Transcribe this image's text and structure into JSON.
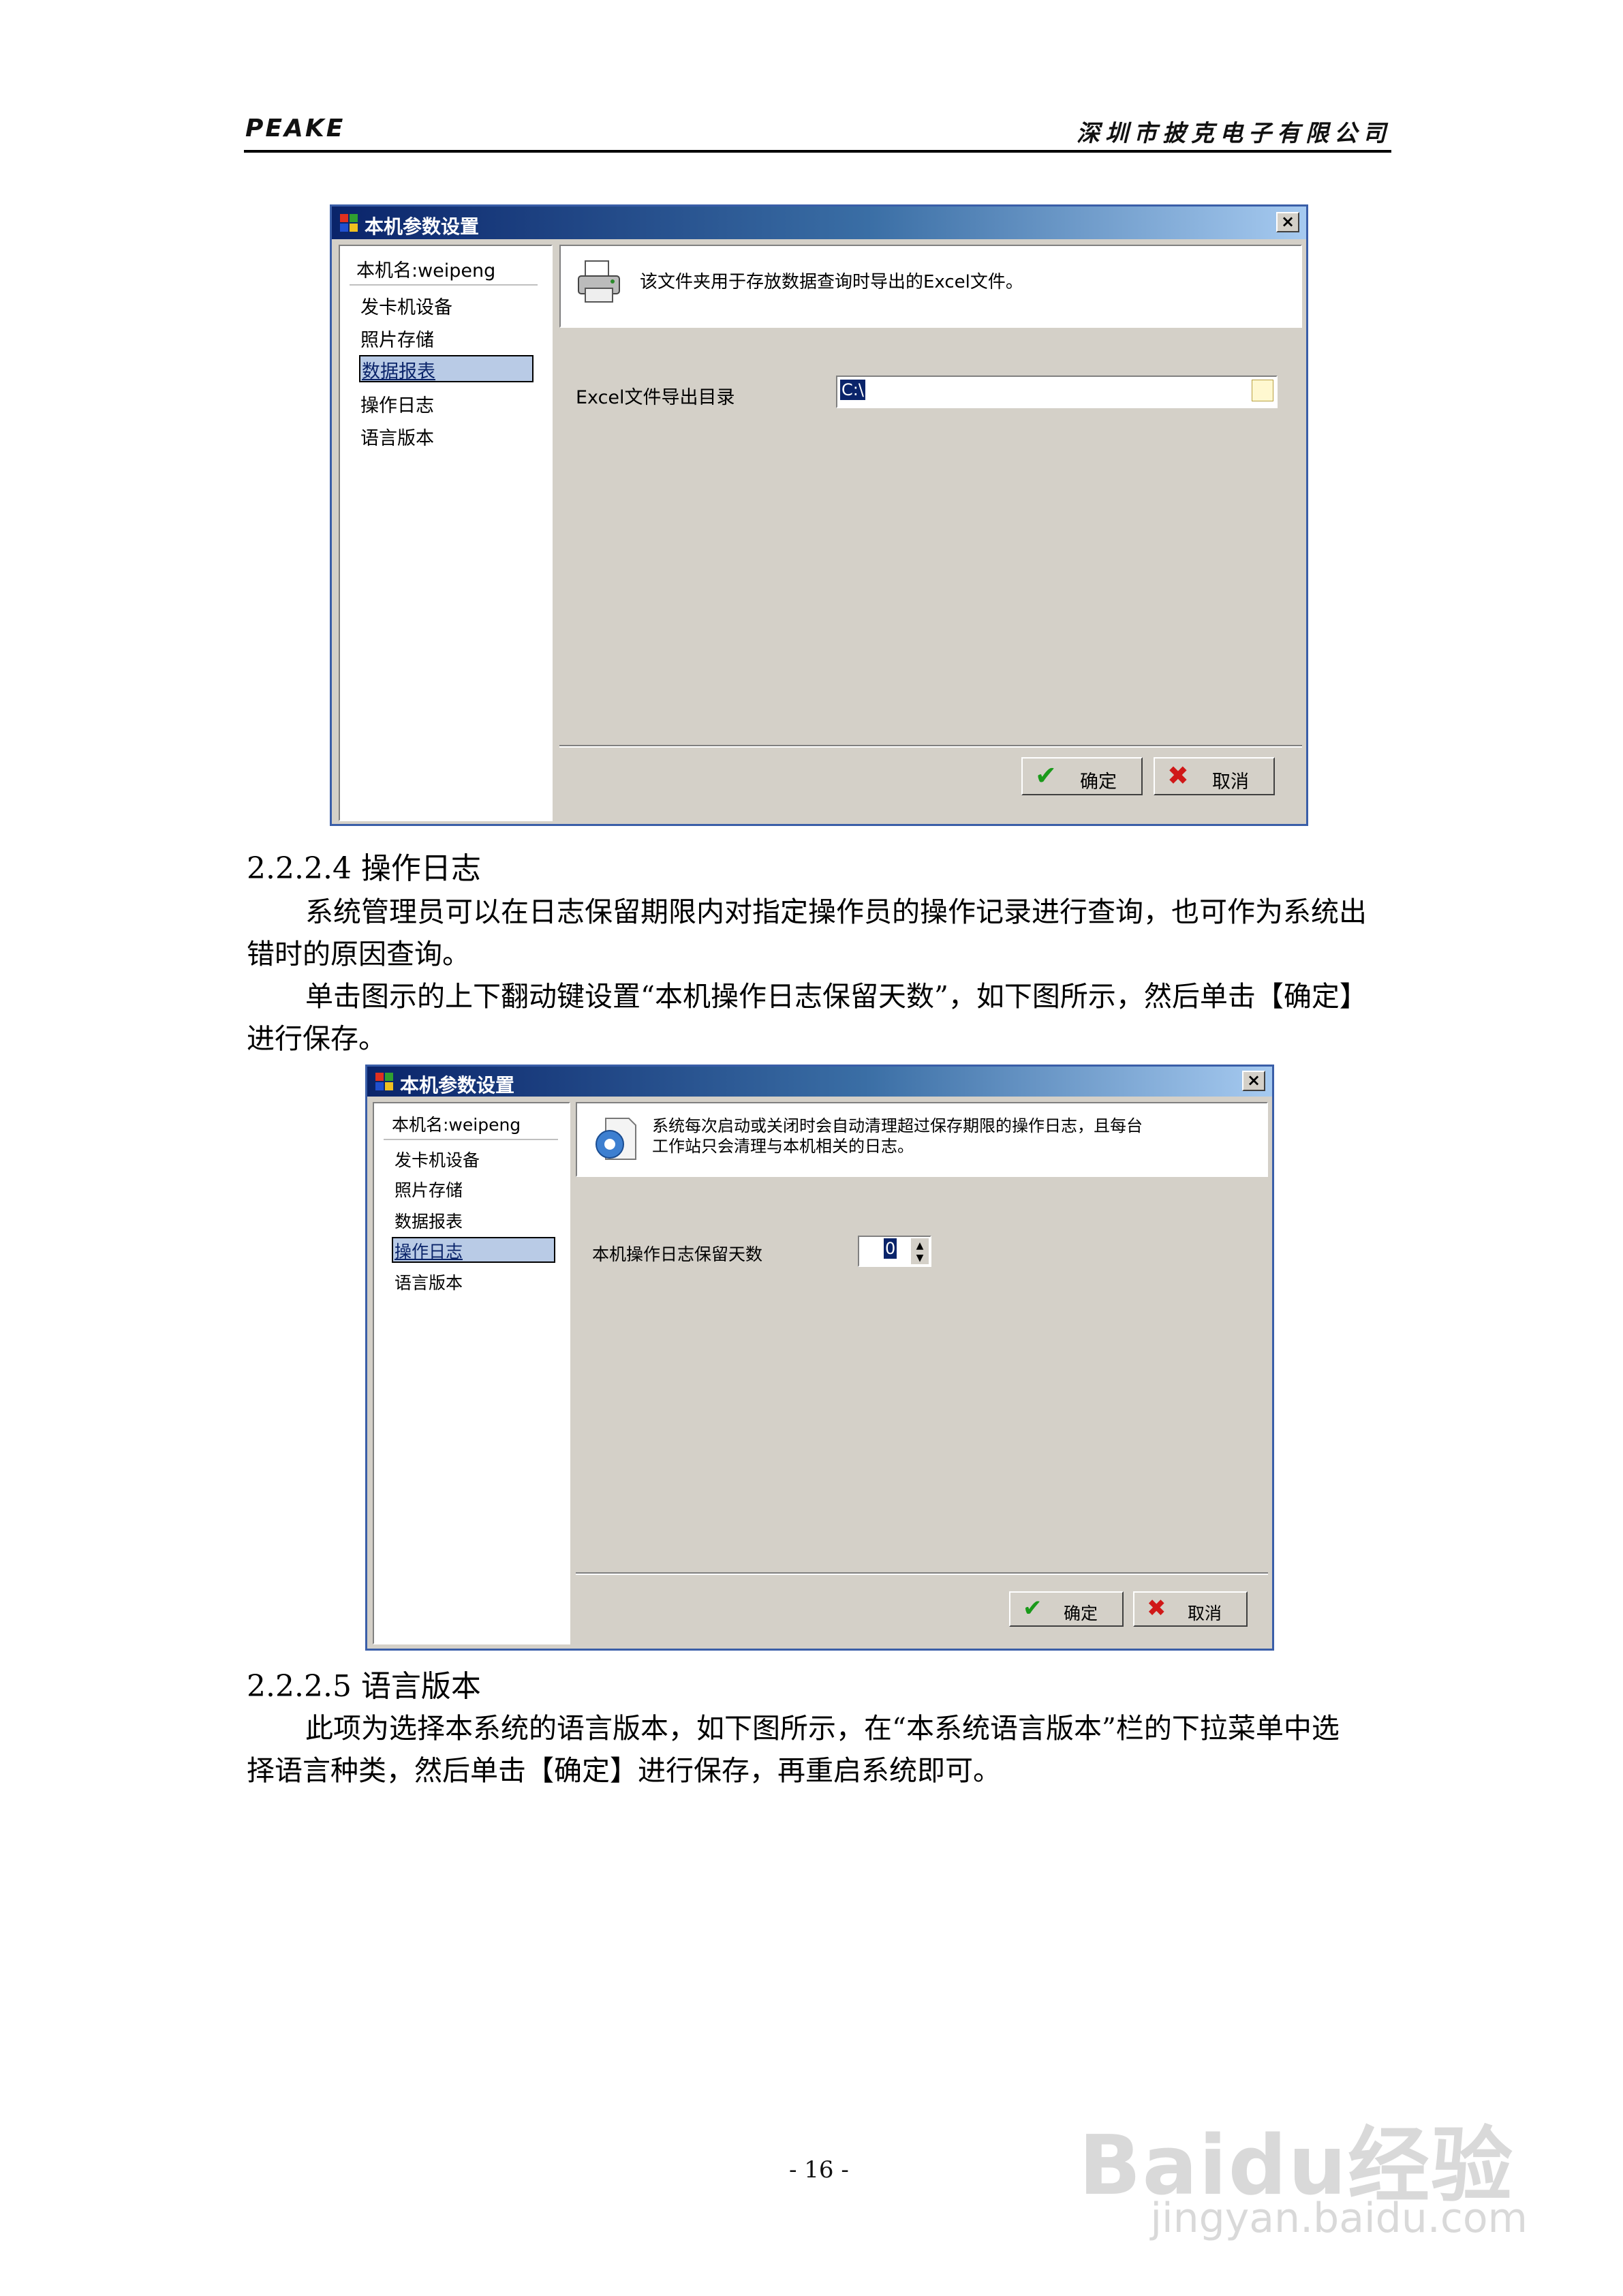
{
  "header": {
    "left": "PEAKE",
    "right": "深圳市披克电子有限公司"
  },
  "dialog1": {
    "title": "本机参数设置",
    "close": "×",
    "host": "本机名:weipeng",
    "nav": [
      "发卡机设备",
      "照片存储",
      "数据报表",
      "操作日志",
      "语言版本"
    ],
    "selected": "数据报表",
    "info": "该文件夹用于存放数据查询时导出的Excel文件。",
    "field_label": "Excel文件导出目录",
    "field_value": "C:\\",
    "ok": "确定",
    "cancel": "取消",
    "ok_icon": "✔",
    "cancel_icon": "✖"
  },
  "section_224": {
    "heading": "2.2.2.4  操作日志",
    "p1_line1": "系统管理员可以在日志保留期限内对指定操作员的操作记录进行查询，也可作为系统出",
    "p1_line2": "错时的原因查询。",
    "p2_line1": "单击图示的上下翻动键设置“本机操作日志保留天数”，如下图所示，然后单击【确定】",
    "p2_line2": "进行保存。"
  },
  "dialog2": {
    "title": "本机参数设置",
    "close": "×",
    "host": "本机名:weipeng",
    "nav": [
      "发卡机设备",
      "照片存储",
      "数据报表",
      "操作日志",
      "语言版本"
    ],
    "selected": "操作日志",
    "info_line1": "系统每次启动或关闭时会自动清理超过保存期限的操作日志，且每台",
    "info_line2": "工作站只会清理与本机相关的日志。",
    "field_label": "本机操作日志保留天数",
    "spin_value": "0",
    "ok": "确定",
    "cancel": "取消",
    "ok_icon": "✔",
    "cancel_icon": "✖"
  },
  "section_225": {
    "heading": "2.2.2.5  语言版本",
    "p1_line1": "此项为选择本系统的语言版本，如下图所示，在“本系统语言版本”栏的下拉菜单中选",
    "p1_line2": "择语言种类，然后单击【确定】进行保存，再重启系统即可。"
  },
  "page_number": "- 16 -",
  "watermark": {
    "line1": "Baidu经验",
    "line2": "jingyan.baidu.com"
  }
}
